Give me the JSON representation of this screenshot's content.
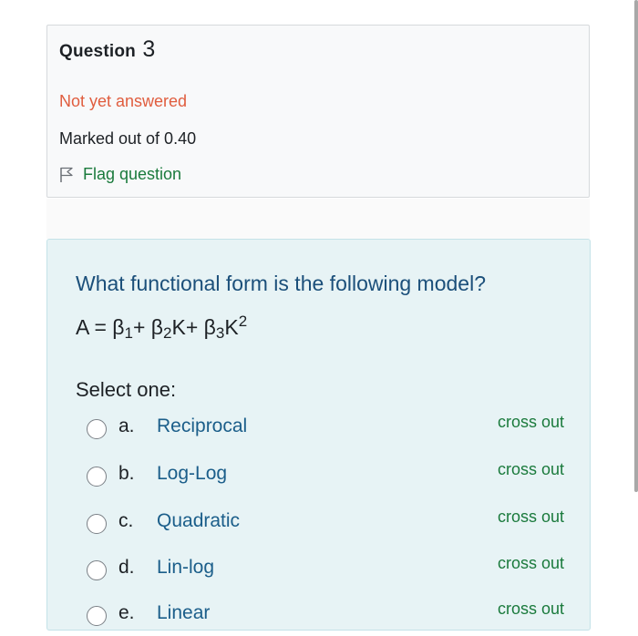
{
  "question": {
    "label": "Question",
    "number": "3",
    "state": "Not yet answered",
    "grade": "Marked out of 0.40",
    "flag_label": "Flag question"
  },
  "formulation": {
    "text": "What functional form is the following model?",
    "formula": {
      "lhs": "A = β",
      "s1": "1",
      "p1": "+ β",
      "s2": "2",
      "p2": "K+ β",
      "s3": "3",
      "p3": "K",
      "sup": "2"
    },
    "prompt": "Select one:",
    "answers": [
      {
        "letter": "a.",
        "text": "Reciprocal",
        "cross": "cross out"
      },
      {
        "letter": "b.",
        "text": "Log-Log",
        "cross": "cross out"
      },
      {
        "letter": "c.",
        "text": "Quadratic",
        "cross": "cross out"
      },
      {
        "letter": "d.",
        "text": "Lin-log",
        "cross": "cross out"
      },
      {
        "letter": "e.",
        "text": "Linear",
        "cross": "cross out"
      }
    ]
  },
  "icons": {
    "flag": "flag-icon"
  },
  "colors": {
    "state": "#e05d3e",
    "link_green": "#1a7a3c",
    "answer_text": "#1b5e8a",
    "question_text": "#1b4f7a",
    "formulation_bg": "#e7f3f5"
  }
}
